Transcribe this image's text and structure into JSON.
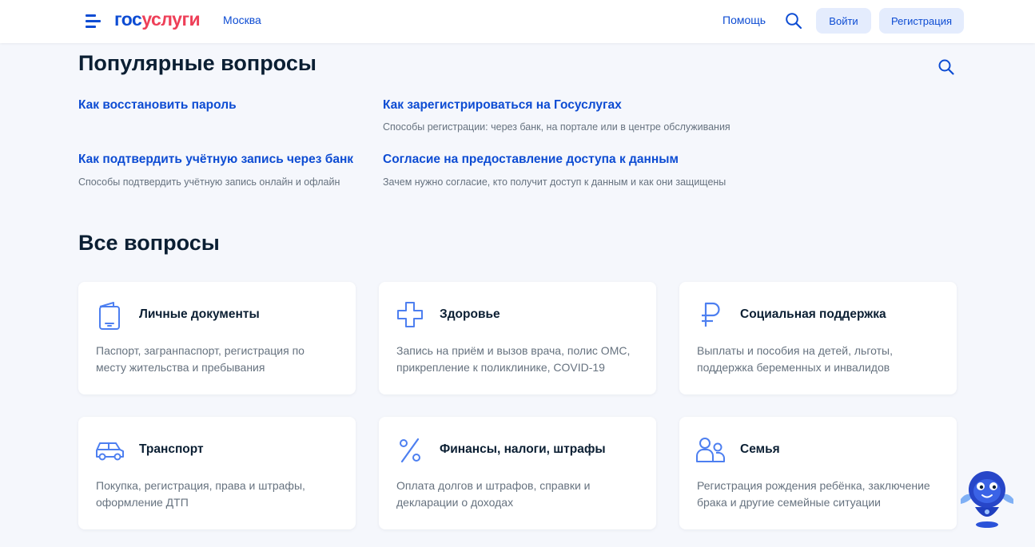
{
  "header": {
    "logo_part1": "гос",
    "logo_part2": "услуги",
    "city": "Москва",
    "help": "Помощь",
    "login": "Войти",
    "register": "Регистрация"
  },
  "popular": {
    "title": "Популярные вопросы",
    "items": [
      {
        "link": "Как восстановить пароль",
        "desc": ""
      },
      {
        "link": "Как зарегистрироваться на Госуслугах",
        "desc": "Способы регистрации: через банк, на портале или в центре обслуживания"
      },
      {
        "link": "Как подтвердить учётную запись через банк",
        "desc": "Способы подтвердить учётную запись онлайн и офлайн"
      },
      {
        "link": "Согласие на предоставление доступа к данным",
        "desc": "Зачем нужно согласие, кто получит доступ к данным и как они защищены"
      }
    ]
  },
  "all": {
    "title": "Все вопросы",
    "cards": [
      {
        "title": "Личные документы",
        "desc": "Паспорт, загранпаспорт, регистрация по месту жительства и пребывания",
        "icon": "document-icon"
      },
      {
        "title": "Здоровье",
        "desc": "Запись на приём и вызов врача, полис ОМС, прикрепление к поликлинике, COVID-19",
        "icon": "health-cross-icon"
      },
      {
        "title": "Социальная поддержка",
        "desc": "Выплаты и пособия на детей, льготы, поддержка беременных и инвалидов",
        "icon": "ruble-icon"
      },
      {
        "title": "Транспорт",
        "desc": "Покупка, регистрация, права и штрафы, оформление ДТП",
        "icon": "car-icon"
      },
      {
        "title": "Финансы, налоги, штрафы",
        "desc": "Оплата долгов и штрафов, справки и декларации о доходах",
        "icon": "percent-icon"
      },
      {
        "title": "Семья",
        "desc": "Регистрация рождения ребёнка, заключение брака и другие семейные ситуации",
        "icon": "family-icon"
      }
    ]
  },
  "colors": {
    "accent": "#0d4cd3",
    "logo_red": "#ee3f58",
    "background": "#f5f7fc",
    "icon_blue": "#4d7ff0"
  }
}
